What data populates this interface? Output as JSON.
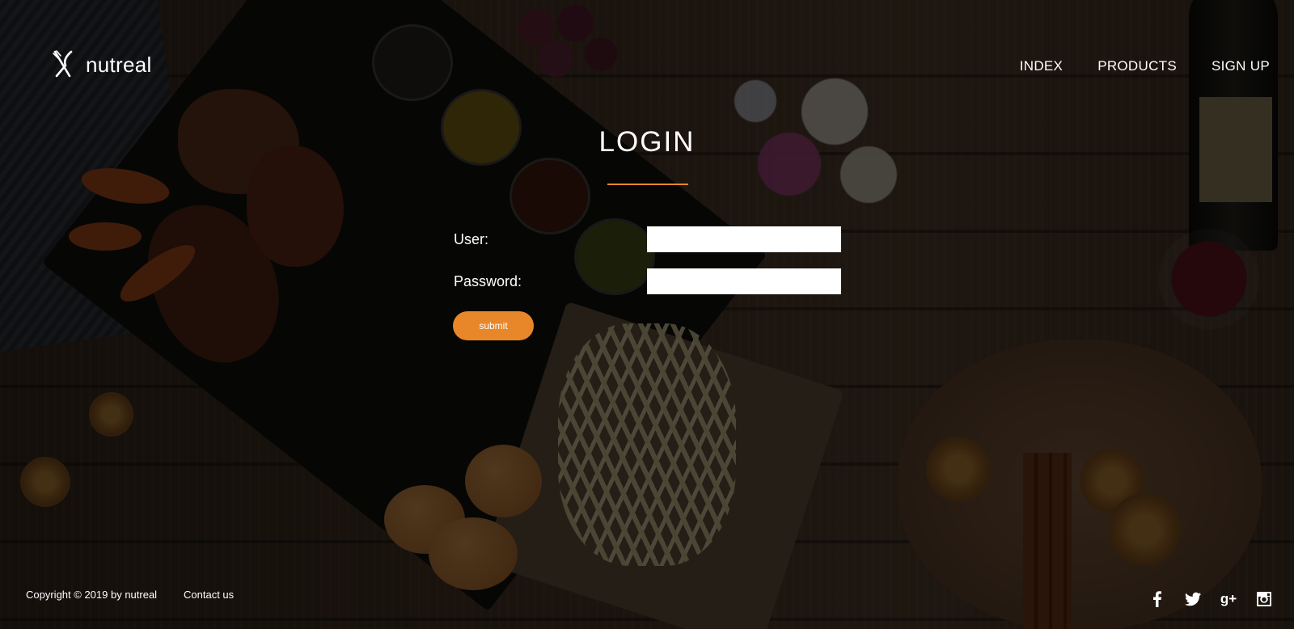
{
  "brand": {
    "name": "nutreal",
    "logo_icon": "fork-knife-icon",
    "accent_color": "#e8862a"
  },
  "nav": {
    "items": [
      {
        "label": "INDEX"
      },
      {
        "label": "PRODUCTS"
      },
      {
        "label": "SIGN UP"
      }
    ]
  },
  "login": {
    "title": "LOGIN",
    "user_label": "User:",
    "user_value": "",
    "password_label": "Password:",
    "password_value": "",
    "submit_label": "submit"
  },
  "footer": {
    "copyright": "Copyright © 2019 by nutreal",
    "contact": "Contact us",
    "social_icons": [
      "facebook-icon",
      "twitter-icon",
      "google-plus-icon",
      "instagram-icon"
    ],
    "google_plus_glyph": "g+"
  }
}
